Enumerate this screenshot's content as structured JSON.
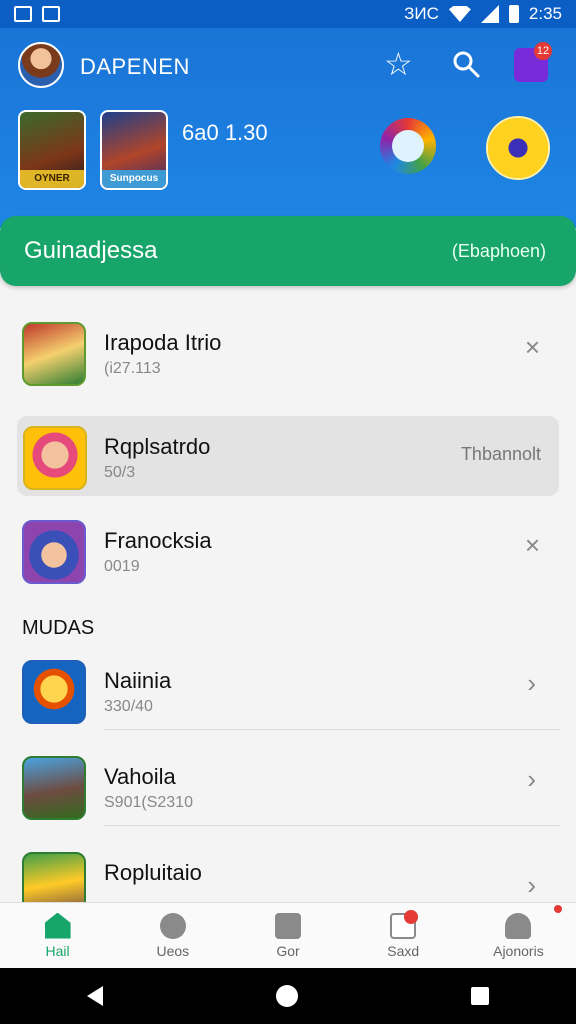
{
  "status_bar": {
    "time": "2:35",
    "carrier_text": "ЗИС"
  },
  "header": {
    "title": "DAPENEN",
    "stat_text": "6a0 1.30",
    "cart_badge": "12",
    "featured": [
      {
        "label": "OYNER"
      },
      {
        "label": "Sunpocus"
      }
    ]
  },
  "banner": {
    "title": "Guinadjessa",
    "link": "(Ebaphoen)"
  },
  "section_label": "MUDAS",
  "rows": [
    {
      "title": "Irapoda Itrio",
      "subtitle": "(i27.113",
      "action": "×"
    },
    {
      "title": "Rqplsatrdo",
      "subtitle": "50/3",
      "action_text": "Thbannolt"
    },
    {
      "title": "Franocksia",
      "subtitle": "0019",
      "action": "×"
    }
  ],
  "rows2": [
    {
      "title": "Naiinia",
      "subtitle": "330/40",
      "action": "›"
    },
    {
      "title": "Vahoila",
      "subtitle": "S901(S2310",
      "action": "›"
    },
    {
      "title": "Ropluitaio",
      "subtitle": "",
      "action": "›"
    }
  ],
  "bottom_nav": [
    {
      "label": "Hail"
    },
    {
      "label": "Ueos"
    },
    {
      "label": "Gor"
    },
    {
      "label": "Saxd"
    },
    {
      "label": "Ajonoris"
    }
  ],
  "bottom_nav_badge": "1",
  "colors": {
    "header": "#1e86e6",
    "banner": "#17a56a",
    "accent": "#17a56a"
  }
}
